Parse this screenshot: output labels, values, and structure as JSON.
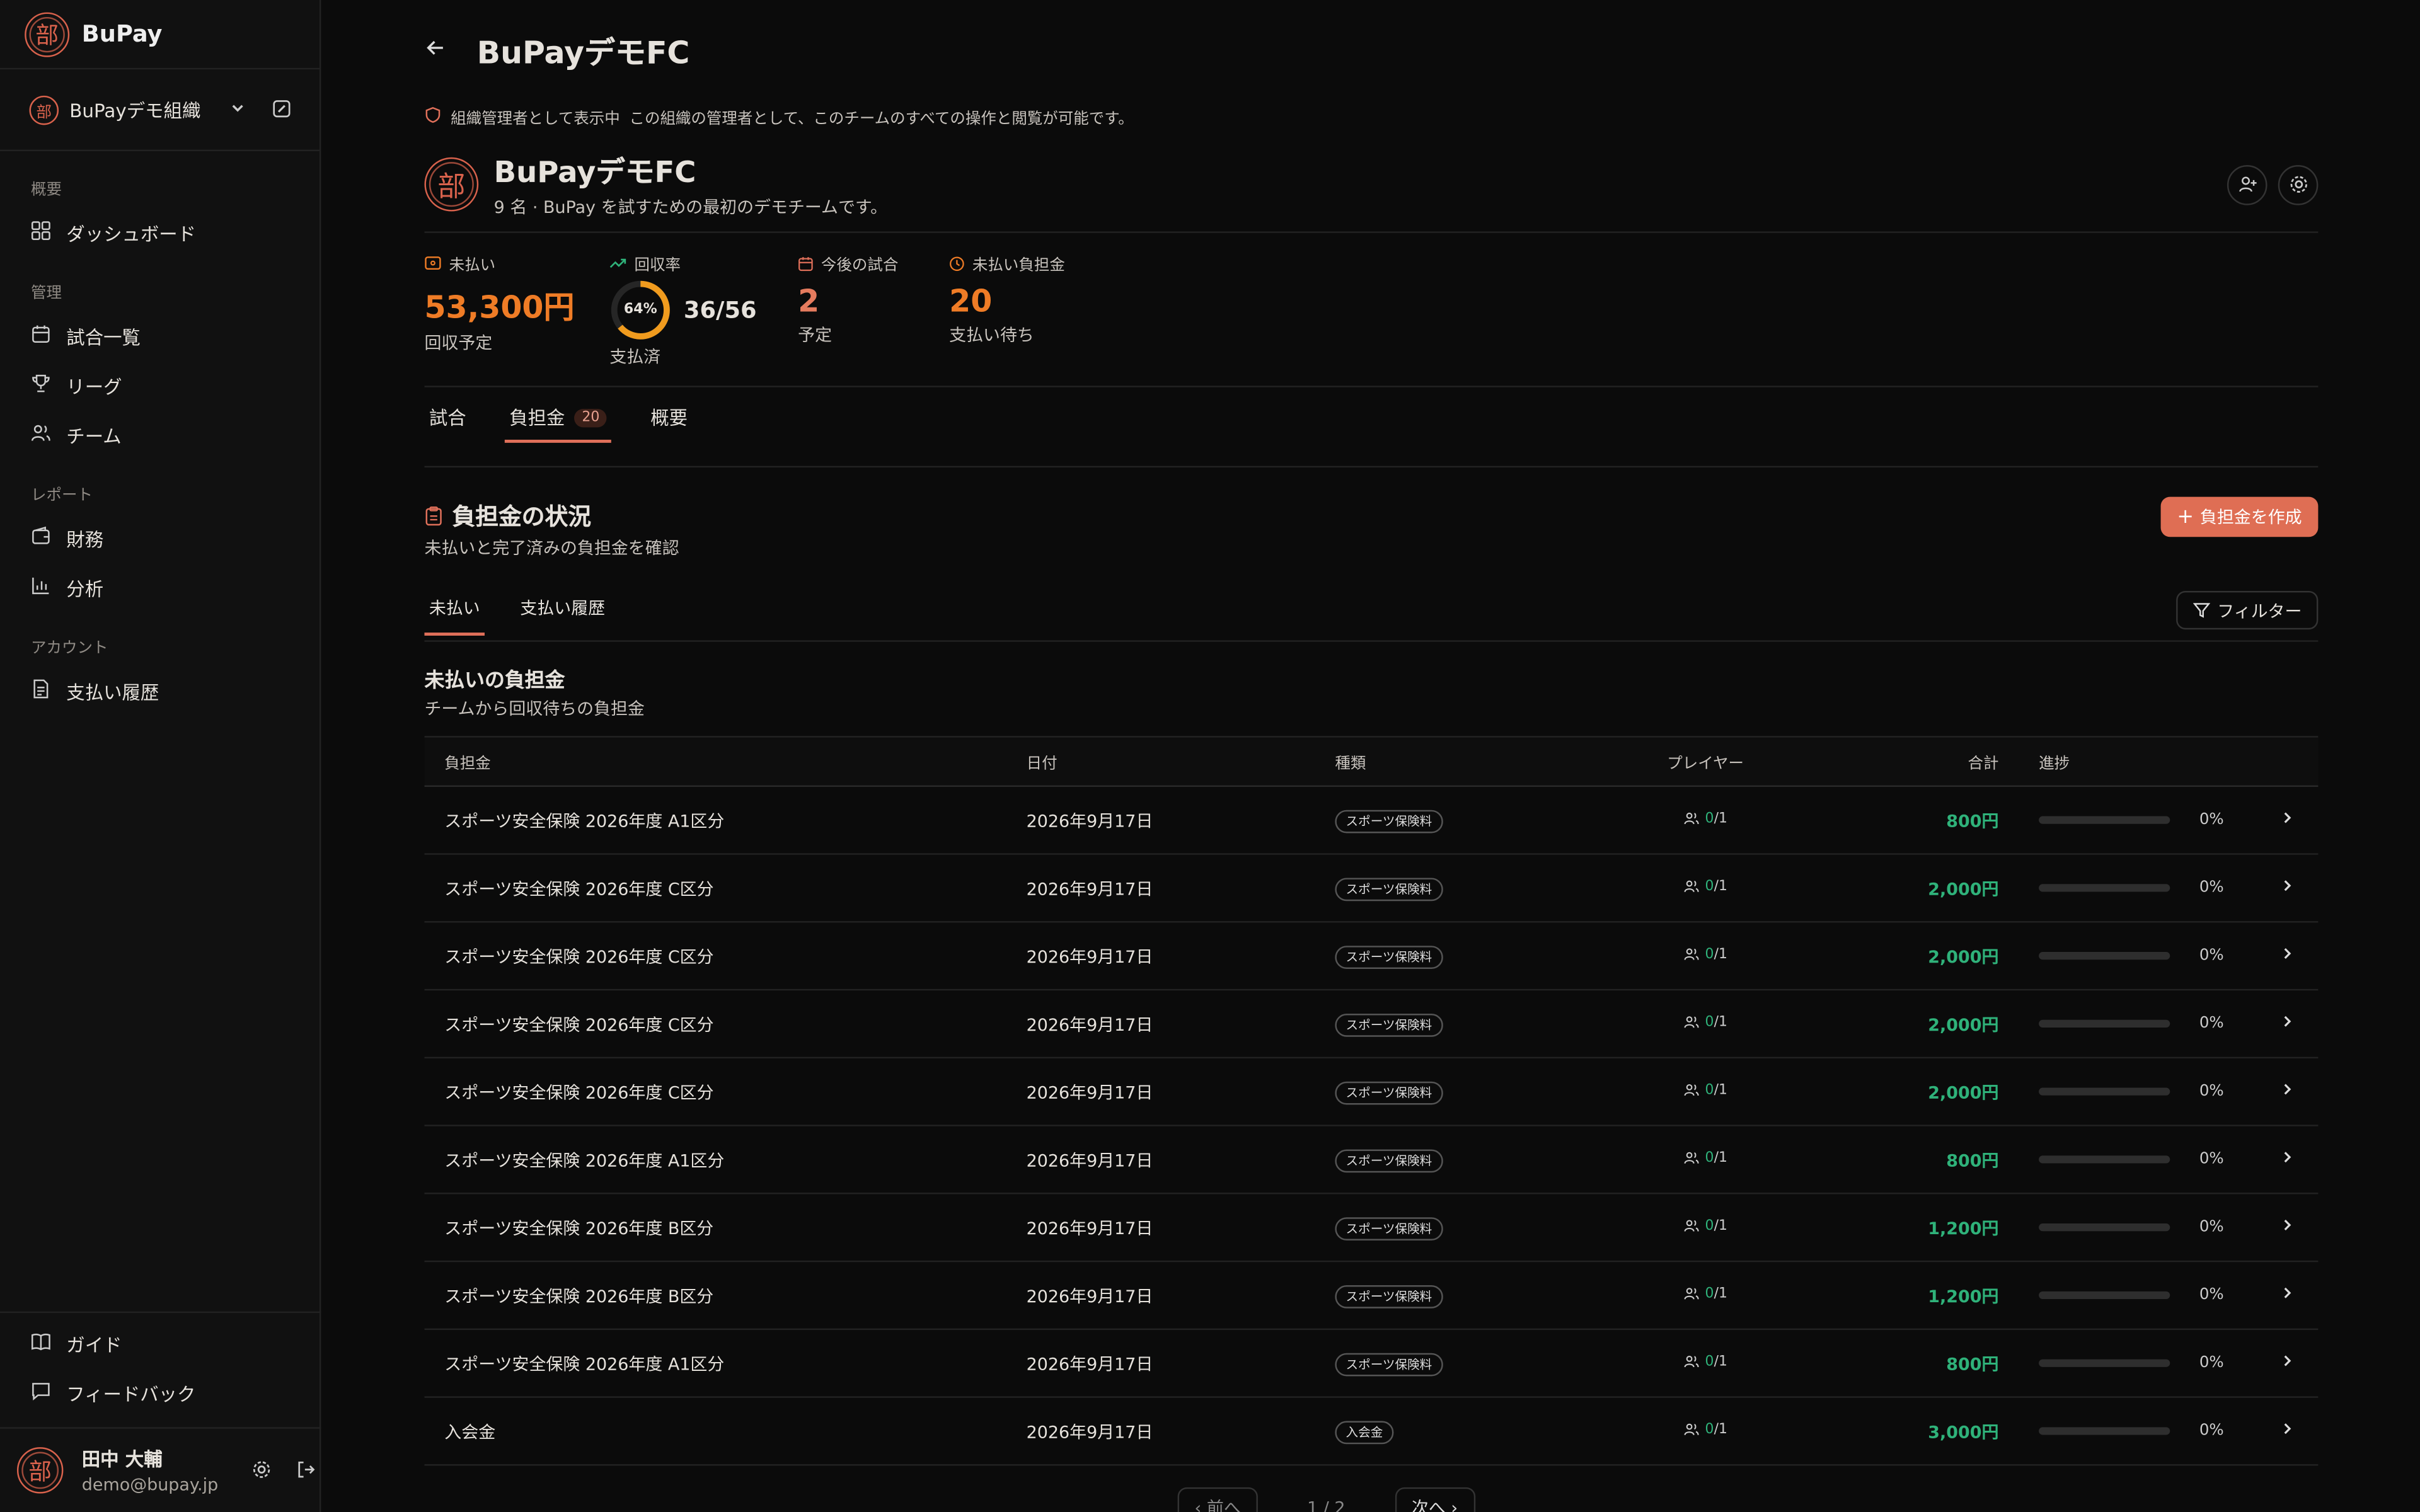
{
  "sidebar": {
    "brand": "BuPay",
    "seal_char": "部",
    "org_name": "BuPayデモ組織",
    "groups": [
      {
        "label": "概要",
        "items": [
          {
            "label": "ダッシュボード",
            "icon": "dashboard-icon"
          }
        ]
      },
      {
        "label": "管理",
        "items": [
          {
            "label": "試合一覧",
            "icon": "calendar-icon"
          },
          {
            "label": "リーグ",
            "icon": "trophy-icon"
          },
          {
            "label": "チーム",
            "icon": "users-icon"
          }
        ]
      },
      {
        "label": "レポート",
        "items": [
          {
            "label": "財務",
            "icon": "wallet-icon"
          },
          {
            "label": "分析",
            "icon": "bar-chart-icon"
          }
        ]
      },
      {
        "label": "アカウント",
        "items": [
          {
            "label": "支払い履歴",
            "icon": "receipt-icon"
          }
        ]
      }
    ],
    "bottom_items": [
      {
        "label": "ガイド",
        "icon": "book-icon"
      },
      {
        "label": "フィードバック",
        "icon": "message-icon"
      }
    ],
    "user": {
      "name": "田中 大輔",
      "email": "demo@bupay.jp"
    }
  },
  "header": {
    "title": "BuPayデモFC"
  },
  "notice": {
    "tag": "組織管理者として表示中",
    "text": "この組織の管理者として、このチームのすべての操作と閲覧が可能です。"
  },
  "team": {
    "name": "BuPayデモFC",
    "desc": "9 名 · BuPay を試すための最初のデモチームです。"
  },
  "stats": {
    "unpaid": {
      "label": "未払い",
      "value": "53,300円",
      "sub": "回収予定"
    },
    "rate": {
      "label": "回収率",
      "percent": 64,
      "percent_label": "64%",
      "ratio": "36/56",
      "sub": "支払済"
    },
    "upcoming": {
      "label": "今後の試合",
      "value": "2",
      "sub": "予定"
    },
    "pending": {
      "label": "未払い負担金",
      "value": "20",
      "sub": "支払い待ち"
    }
  },
  "tabs": [
    {
      "label": "試合"
    },
    {
      "label": "負担金",
      "count": "20"
    },
    {
      "label": "概要"
    }
  ],
  "section": {
    "title": "負担金の状況",
    "subtitle": "未払いと完了済みの負担金を確認",
    "create_label": "負担金を作成"
  },
  "subtabs": {
    "unpaid": "未払い",
    "history": "支払い履歴",
    "filter": "フィルター"
  },
  "table": {
    "title": "未払いの負担金",
    "subtitle": "チームから回収待ちの負担金",
    "columns": {
      "name": "負担金",
      "date": "日付",
      "kind": "種類",
      "player": "プレイヤー",
      "total": "合計",
      "progress": "進捗"
    },
    "rows": [
      {
        "name": "スポーツ安全保険 2026年度 A1区分",
        "date": "2026年9月17日",
        "kind": "スポーツ保険料",
        "paid": "0",
        "players": "/1",
        "total": "800円",
        "progress": 0,
        "pct": "0%"
      },
      {
        "name": "スポーツ安全保険 2026年度 C区分",
        "date": "2026年9月17日",
        "kind": "スポーツ保険料",
        "paid": "0",
        "players": "/1",
        "total": "2,000円",
        "progress": 0,
        "pct": "0%"
      },
      {
        "name": "スポーツ安全保険 2026年度 C区分",
        "date": "2026年9月17日",
        "kind": "スポーツ保険料",
        "paid": "0",
        "players": "/1",
        "total": "2,000円",
        "progress": 0,
        "pct": "0%"
      },
      {
        "name": "スポーツ安全保険 2026年度 C区分",
        "date": "2026年9月17日",
        "kind": "スポーツ保険料",
        "paid": "0",
        "players": "/1",
        "total": "2,000円",
        "progress": 0,
        "pct": "0%"
      },
      {
        "name": "スポーツ安全保険 2026年度 C区分",
        "date": "2026年9月17日",
        "kind": "スポーツ保険料",
        "paid": "0",
        "players": "/1",
        "total": "2,000円",
        "progress": 0,
        "pct": "0%"
      },
      {
        "name": "スポーツ安全保険 2026年度 A1区分",
        "date": "2026年9月17日",
        "kind": "スポーツ保険料",
        "paid": "0",
        "players": "/1",
        "total": "800円",
        "progress": 0,
        "pct": "0%"
      },
      {
        "name": "スポーツ安全保険 2026年度 B区分",
        "date": "2026年9月17日",
        "kind": "スポーツ保険料",
        "paid": "0",
        "players": "/1",
        "total": "1,200円",
        "progress": 0,
        "pct": "0%"
      },
      {
        "name": "スポーツ安全保険 2026年度 B区分",
        "date": "2026年9月17日",
        "kind": "スポーツ保険料",
        "paid": "0",
        "players": "/1",
        "total": "1,200円",
        "progress": 0,
        "pct": "0%"
      },
      {
        "name": "スポーツ安全保険 2026年度 A1区分",
        "date": "2026年9月17日",
        "kind": "スポーツ保険料",
        "paid": "0",
        "players": "/1",
        "total": "800円",
        "progress": 0,
        "pct": "0%"
      },
      {
        "name": "入会金",
        "date": "2026年9月17日",
        "kind": "入会金",
        "paid": "0",
        "players": "/1",
        "total": "3,000円",
        "progress": 0,
        "pct": "0%"
      }
    ]
  },
  "pager": {
    "prev": "前へ",
    "page": "1 / 2",
    "next": "次へ"
  },
  "colors": {
    "accent": "#df6e54",
    "orange": "#ef7c26",
    "green": "#2fb27a",
    "background": "#0b0b0b"
  }
}
